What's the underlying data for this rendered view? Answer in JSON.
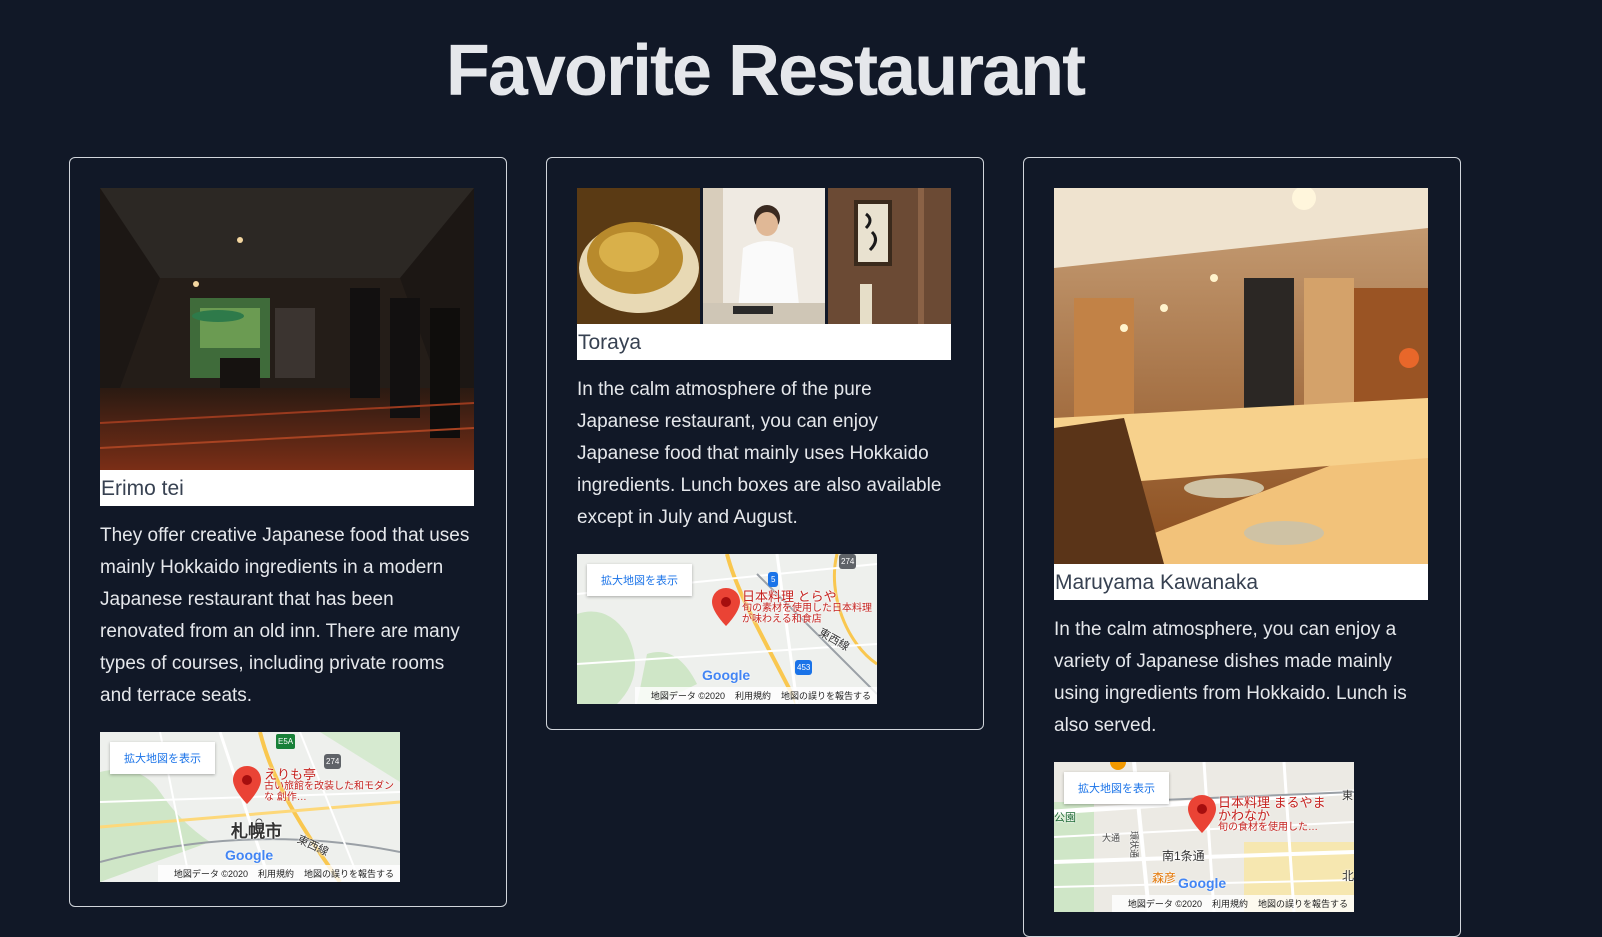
{
  "page": {
    "title": "Favorite Restaurant"
  },
  "restaurants": [
    {
      "name": "Erimo tei",
      "description": "They offer creative Japanese food that uses mainly Hokkaido ingredients in a modern Japanese restaurant that has been renovated from an old inn. There are many types of courses, including private rooms and terrace seats.",
      "map": {
        "enlarge_label": "拡大地図を表示",
        "place_name": "えりも亭",
        "place_desc": "古い旅館を改装した和モダンな 創作…",
        "city_label": "札幌市",
        "line_label": "東西線",
        "road_label_1": "274",
        "road_label_2": "E5A"
      }
    },
    {
      "name": "Toraya",
      "description": "In the calm atmosphere of the pure Japanese restaurant, you can enjoy Japanese food that mainly uses Hokkaido ingredients. Lunch boxes are also available except in July and August.",
      "map": {
        "enlarge_label": "拡大地図を表示",
        "place_name": "日本料理 とらや",
        "place_desc": "旬の素材を使用した日本料理が味わえる和食店",
        "line_label": "東西線",
        "road_label_1": "274",
        "road_label_2": "5",
        "road_label_3": "453"
      }
    },
    {
      "name": "Maruyama Kawanaka",
      "description": "In the calm atmosphere, you can enjoy a variety of Japanese dishes made mainly using ingredients from Hokkaido. Lunch is also served.",
      "map": {
        "enlarge_label": "拡大地図を表示",
        "place_name": "日本料理 まるやまかわなか",
        "place_desc": "旬の食材を使用した…",
        "park_label": "公園",
        "street_label_1": "大通",
        "street_label_2": "南1条通",
        "street_label_3": "環状通",
        "shop_label": "森彦",
        "east_label": "東",
        "north_label": "北"
      }
    }
  ],
  "map_common": {
    "google": "Google",
    "map_data": "地図データ ©2020",
    "terms": "利用規約",
    "report": "地図の誤りを報告する"
  },
  "colors": {
    "background": "#111827",
    "text": "#e5e7eb",
    "pin": "#ea4335",
    "map_link": "#1a73e8"
  }
}
